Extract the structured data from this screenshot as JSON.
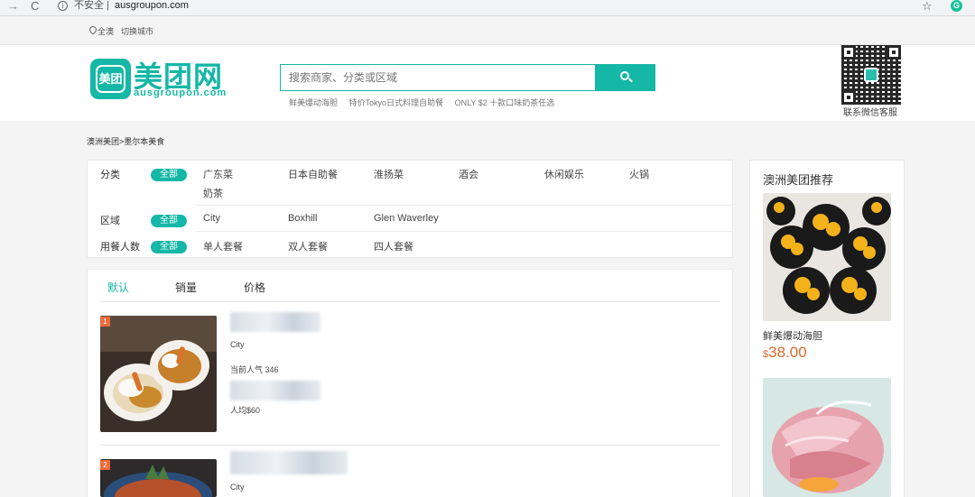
{
  "browser": {
    "back": "→",
    "reload": "C",
    "info": "i",
    "security": "不安全 |",
    "url": "ausgroupon.com",
    "star": "☆",
    "extension": "G"
  },
  "topbar": {
    "region": "全澳",
    "switch_city": "切换城市"
  },
  "logo": {
    "badge": "美团",
    "name": "美团网",
    "sub": "ausgroupon.com"
  },
  "search": {
    "placeholder": "搜索商家、分类或区域",
    "hot": [
      "鲜美爆动海胆",
      "特价Tokyo日式料理自助餐",
      "ONLY $2 十款口味奶茶任选"
    ]
  },
  "qr": {
    "caption": "联系微信客服"
  },
  "breadcrumb": "澳洲美团>墨尔本美食",
  "filters": [
    {
      "label": "分类",
      "all": "全部",
      "options": [
        "广东菜",
        "日本自助餐",
        "淮扬菜",
        "酒会",
        "休闲娱乐",
        "火锅",
        "奶茶"
      ]
    },
    {
      "label": "区域",
      "all": "全部",
      "options": [
        "City",
        "Boxhill",
        "Glen Waverley"
      ]
    },
    {
      "label": "用餐人数",
      "all": "全部",
      "options": [
        "单人套餐",
        "双人套餐",
        "四人套餐"
      ]
    }
  ],
  "sort_tabs": [
    "默认",
    "销量",
    "价格"
  ],
  "items": [
    {
      "rank": "1",
      "area": "City",
      "popularity": "当前人气 346",
      "price_line": "人均$60"
    },
    {
      "rank": "2",
      "area": "City"
    }
  ],
  "sidebar": {
    "title": "澳洲美团推荐",
    "recommendation": {
      "name": "鲜美爆动海胆",
      "currency": "$",
      "price": "38.00"
    }
  },
  "colors": {
    "accent": "#15b7a6",
    "price": "#e0692d",
    "badge": "#ee6a3e"
  }
}
